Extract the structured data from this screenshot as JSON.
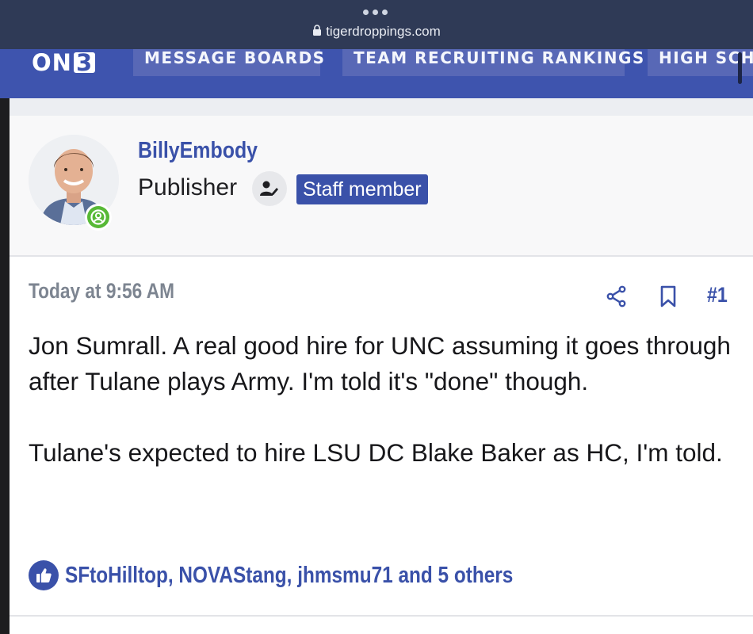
{
  "browser": {
    "url": "tigerdroppings.com"
  },
  "site_nav": {
    "logo_text": "ON",
    "logo_number": "3",
    "tabs": [
      {
        "label": "MESSAGE BOARDS"
      },
      {
        "label": "TEAM RECRUITING RANKINGS"
      },
      {
        "label": "HIGH SCHO"
      }
    ]
  },
  "user": {
    "username": "BillyEmbody",
    "title": "Publisher",
    "badge": "Staff member",
    "online_status_color": "#57b936"
  },
  "post": {
    "timestamp": "Today at 9:56 AM",
    "number": "#1",
    "paragraphs": [
      "Jon Sumrall. A real good hire for UNC assuming it goes through after Tulane plays Army. I'm told it's \"done\" though.",
      "Tulane's expected to hire LSU DC Blake Baker as HC, I'm told."
    ],
    "reactions": "SFtoHilltop, NOVAStang, jhmsmu71 and 5 others"
  },
  "colors": {
    "brand": "#3e54ae",
    "accent": "#3a51a9",
    "browser_bar": "#2f3a56"
  },
  "icons": [
    "lock-icon",
    "person-edit-icon",
    "share-icon",
    "bookmark-icon",
    "thumbs-up-icon",
    "user-circle-icon"
  ]
}
